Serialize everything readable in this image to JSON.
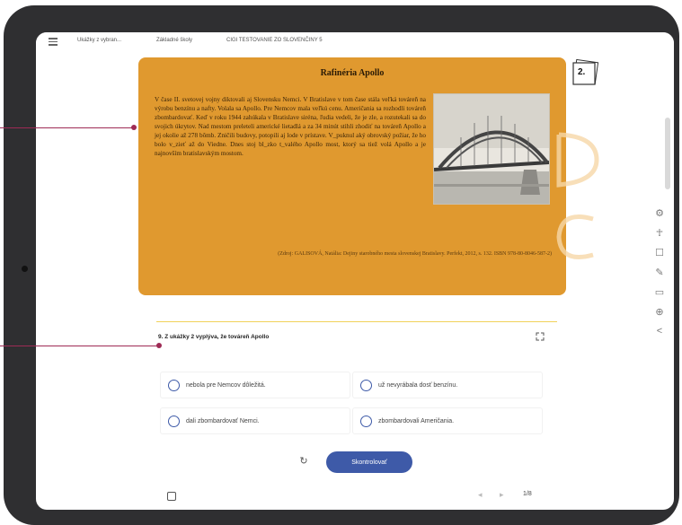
{
  "breadcrumb": {
    "item1": "Ukážky z vybran...",
    "item2": "Základné školy",
    "item3": "CIGI TESTOVANIE ZO SLOVENČINY 5"
  },
  "article": {
    "title": "Rafinéria Apollo",
    "body": "V čase II. svetovej vojny diktovali aj Slovensku Nemci. V Bratislave v tom čase stála veľká továreň na výrobu benzínu a nafty. Volala sa Apollo. Pre Nemcov mala veľkú cenu. Američania sa rozhodli továreň zbombardovať. Keď v roku 1944 zahúkala v Bratislave siréna, ľudia vedeli, že je zle, a rozutekali sa do svojich úkrytov. Nad mestom preleteli americké lietadlá a za 34 minút stihli zhodiť na továreň Apollo a jej okolie až 278 bômb. Zničili budovy, potopili aj lode v prístave. V_puknul aký obrovský požiar, že ho bolo v_zieť až do Viedne. Dnes stoj bl_zko t_valého Apollo most, ktorý sa tiež volá Apollo a je najnovším bratislavským mostom.",
    "citation": "(Zdroj: GALISOVÁ, Natália: Dejiny starobného mesta slovenskej Bratislavy. Perfekt, 2012, s. 132. ISBN 978-80-8046-587-2)",
    "number": "2."
  },
  "question": {
    "title": "9. Z ukážky 2 vyplýva, že továreň Apollo",
    "options": [
      "nebola pre Nemcov dôležitá.",
      "už nevyrábala dosť benzínu.",
      "dali zbombardovať Nemci.",
      "zbombardovali Američania."
    ],
    "check_label": "Skontrolovať"
  },
  "pager": {
    "page": "1/8"
  },
  "tools": [
    "gear-icon",
    "accessibility-icon",
    "square-icon",
    "pencil-icon",
    "monitor-icon",
    "crosshair-icon",
    "share-icon"
  ]
}
